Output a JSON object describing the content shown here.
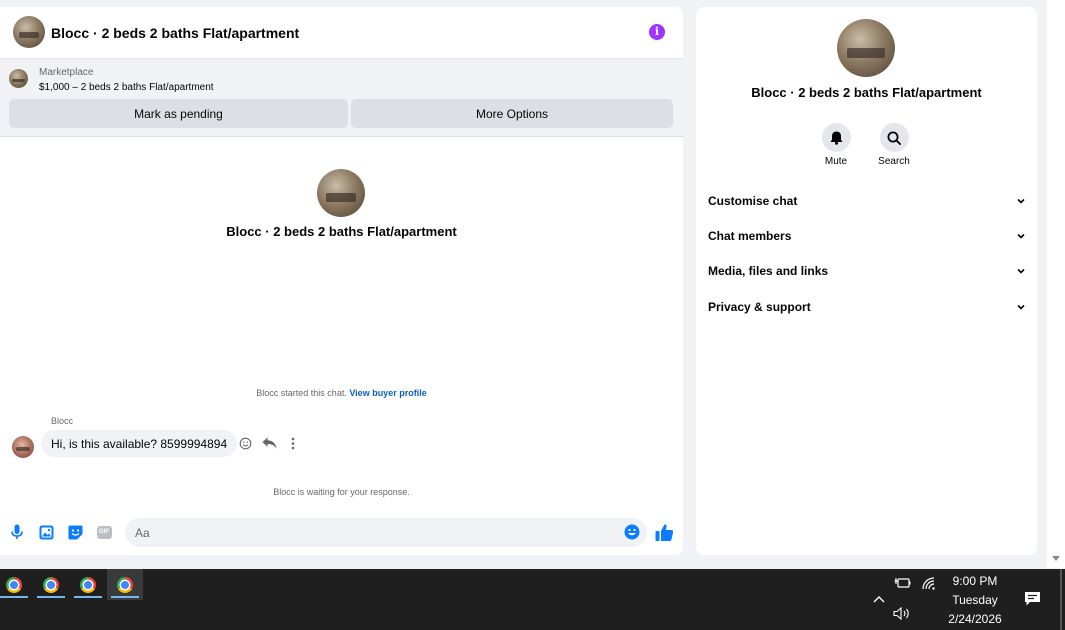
{
  "chat": {
    "title": "Blocc · 2 beds 2 baths Flat/apartment",
    "marketplace_label": "Marketplace",
    "listing": "$1,000 – 2 beds 2 baths Flat/apartment",
    "mark_pending_label": "Mark as pending",
    "more_options_label": "More Options",
    "center_title": "Blocc · 2 beds 2 baths Flat/apartment",
    "started_text": "Blocc started this chat.",
    "view_profile_link": "View buyer profile",
    "sender": "Blocc",
    "message": "Hi, is this available? 8599994894",
    "waiting_text": "Blocc is waiting for your response.",
    "input_placeholder": "Aa",
    "gif_label": "GIF"
  },
  "info": {
    "title": "Blocc · 2 beds 2 baths Flat/apartment",
    "mute_label": "Mute",
    "search_label": "Search",
    "sections": [
      "Customise chat",
      "Chat members",
      "Media, files and links",
      "Privacy & support"
    ]
  },
  "taskbar": {
    "time": "9:00 PM",
    "day": "Tuesday",
    "date": "2/24/2026"
  },
  "colors": {
    "accent": "#0a7cff",
    "info_icon": "#a033ff",
    "link": "#0a5dc2"
  }
}
